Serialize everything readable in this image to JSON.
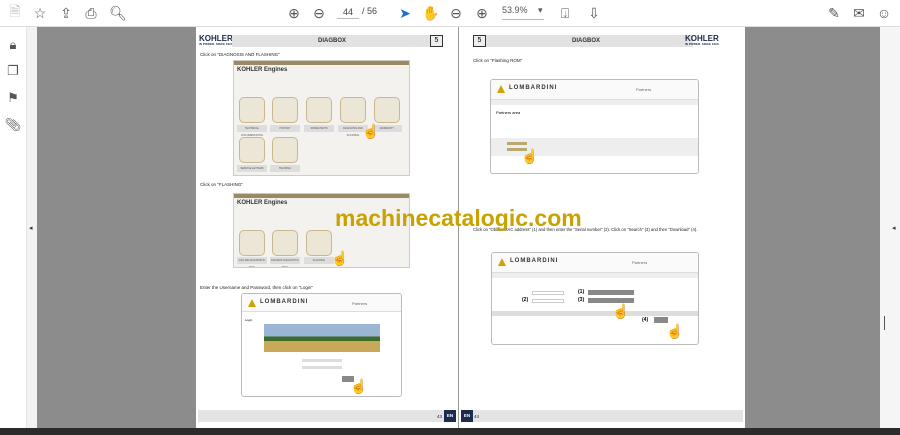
{
  "toolbar": {
    "current_page": "44",
    "total_pages": "/ 56",
    "zoom": "53.9%",
    "icons": [
      "save-icon",
      "bookmark-star-icon",
      "upload-icon",
      "print-icon",
      "search-icon",
      "prev-page-icon",
      "next-page-icon",
      "select-cursor-icon",
      "hand-icon",
      "zoom-out-icon",
      "zoom-in-icon",
      "fit-page-icon",
      "scroll-mode-icon",
      "sign-icon",
      "email-icon",
      "account-icon"
    ]
  },
  "sidebar": {
    "icons": [
      "lock-icon",
      "pages-icon",
      "bookmark-icon",
      "attachment-icon"
    ]
  },
  "watermark": "machinecatalogic.com",
  "left_page": {
    "brand": "KOHLER",
    "tagline": "IN POWER. SINCE 1920.",
    "title": "DIAGBOX",
    "section": "5",
    "step1": "Click on \"DIAGNOSIS AND FLASHING\"",
    "step2": "Click on \"FLASHING\"",
    "step3": "Enter the Username and Password, then click on \"Login\"",
    "kohler_app": "KOHLER Engines",
    "tiles1": [
      "TECHNICAL DOCUMENTATION",
      "HISTORY",
      "SPARE PARTS",
      "DIAGNOSIS AND FLASHING",
      "WARRANTY",
      "SERVICE LETTERS",
      "TRAINING"
    ],
    "tiles2": [
      "ON-LINE DIAGNOSTIC TOOL",
      "DIAGBOX DIAGNOSTIC TOOL",
      "FLASHING"
    ],
    "lombardini": "LOMBARDINI",
    "partners": "Partners",
    "login": "Login",
    "page_number": "43",
    "lang": "EN"
  },
  "right_page": {
    "brand": "KOHLER",
    "tagline": "IN POWER. SINCE 1920.",
    "title": "DIAGBOX",
    "section": "5",
    "step1": "Click on \"Flashing ROM\"",
    "step2": "Click on \"Obtain MAC address\" (1) and then enter the \"Serial number\" (2). Click on \"Search\" (3) and then \"Download\" (4).",
    "lombardini": "LOMBARDINI",
    "partners": "Partners",
    "area": "Partners area",
    "markers": [
      "(1)",
      "(2)",
      "(3)",
      "(4)"
    ],
    "page_number": "44",
    "lang": "EN"
  }
}
